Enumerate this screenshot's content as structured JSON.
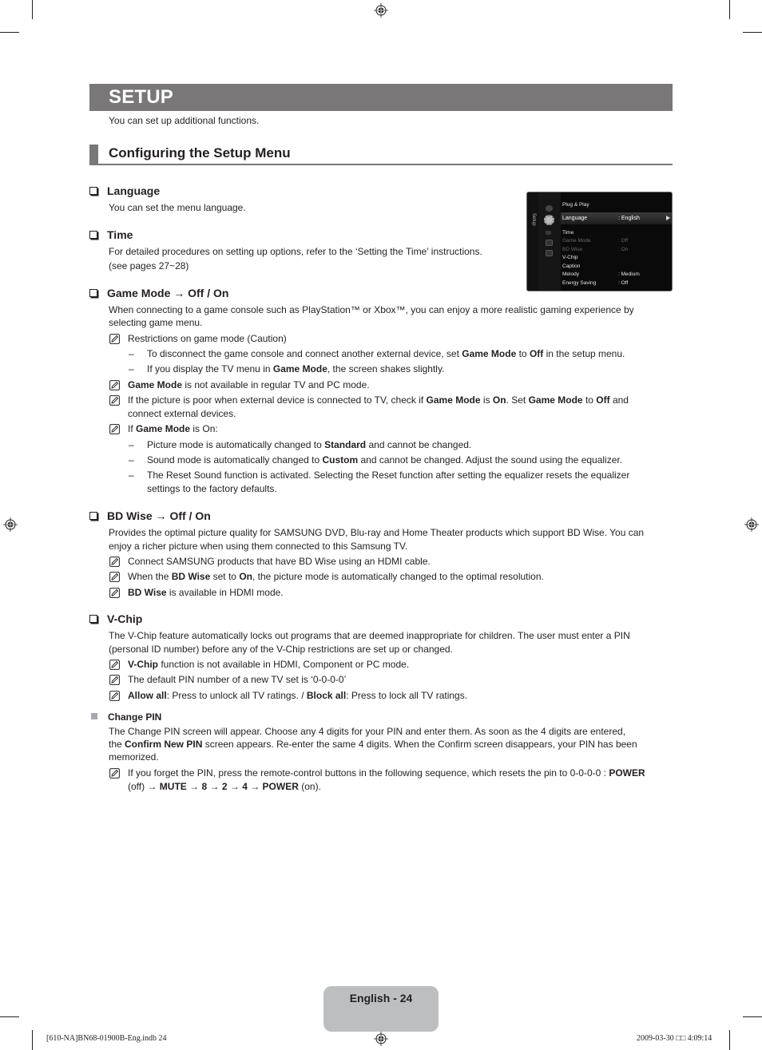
{
  "page": {
    "title": "SETUP",
    "intro": "You can set up additional functions.",
    "section_title": "Configuring the Setup Menu"
  },
  "items": {
    "language": {
      "title": "Language",
      "body": "You can set the menu language."
    },
    "time": {
      "title": "Time",
      "body1": "For detailed procedures on setting up options, refer to the ‘Setting the Time’ instructions.",
      "body2": "(see pages 27~28)"
    },
    "game_mode": {
      "title": "Game Mode → Off / On",
      "body1": "When connecting to a game console such as PlayStation™ or Xbox™, you can enjoy a more realistic gaming experience by",
      "body2": "selecting game menu.",
      "note1": "Restrictions on game mode (Caution)",
      "note1_dash1": {
        "a": "To disconnect the game console and connect another external device, set ",
        "b1": "Game Mode",
        "c": " to ",
        "b2": "Off",
        "d": " in the setup menu."
      },
      "note1_dash2": {
        "a": "If you display the TV menu in ",
        "b1": "Game Mode",
        "c": ", the screen shakes slightly."
      },
      "note2": {
        "b1": "Game Mode",
        "a": " is not available in regular TV and PC mode."
      },
      "note3": {
        "a": "If the picture is poor when external device is connected to TV, check if ",
        "b1": "Game Mode",
        "c": " is ",
        "b2": "On",
        "d": ". Set ",
        "b3": "Game Mode",
        "e": " to ",
        "b4": "Off",
        "f": " and",
        "line2": "connect external devices."
      },
      "note4": {
        "a": "If ",
        "b1": "Game Mode",
        "c": " is On:"
      },
      "note4_dash1": {
        "a": "Picture mode is automatically changed to ",
        "b1": "Standard",
        "c": " and cannot be changed."
      },
      "note4_dash2": {
        "a": "Sound mode is automatically changed to ",
        "b1": "Custom",
        "c": " and cannot be changed. Adjust the sound using the equalizer."
      },
      "note4_dash3": {
        "line1": "The Reset Sound function is activated. Selecting the Reset function after setting the equalizer resets the equalizer",
        "line2": "settings to the factory defaults."
      }
    },
    "bd_wise": {
      "title": "BD Wise → Off / On",
      "body1": "Provides the optimal picture quality for SAMSUNG DVD, Blu-ray and Home Theater products which support BD Wise. You can",
      "body2": "enjoy a richer picture when using them connected to this Samsung TV.",
      "note1": "Connect SAMSUNG products that have BD Wise using an HDMI cable.",
      "note2": {
        "a": "When the ",
        "b1": "BD Wise",
        "c": " set to ",
        "b2": "On",
        "d": ", the picture mode is automatically changed to the optimal resolution."
      },
      "note3": {
        "b1": "BD Wise",
        "a": " is available in HDMI mode."
      }
    },
    "v_chip": {
      "title": "V-Chip",
      "body1": "The V-Chip feature automatically locks out programs that are deemed inappropriate for children. The user must enter a PIN",
      "body2": "(personal ID number) before any of the V-Chip restrictions are set up or changed.",
      "note1": {
        "b1": "V-Chip",
        "a": " function is not available in HDMI, Component or PC mode."
      },
      "note2": "The default PIN number of a new TV set is ‘0-0-0-0’",
      "note3": {
        "b1": "Allow all",
        "a": ": Press to unlock all TV ratings. / ",
        "b2": "Block all",
        "c": ": Press to lock all TV ratings."
      }
    },
    "change_pin": {
      "title": "Change PIN",
      "body1": "The Change PIN screen will appear. Choose any 4 digits for your PIN and enter them. As soon as the 4 digits are entered,",
      "body2": {
        "a": "the ",
        "b1": "Confirm New PIN",
        "c": " screen appears. Re-enter the same 4 digits. When the Confirm screen disappears, your PIN has been"
      },
      "body3": "memorized.",
      "note1": {
        "a": "If you forget the PIN, press the remote-control buttons in the following sequence, which resets the pin to 0-0-0-0 : ",
        "b1": "POWER",
        "c": "(off) → ",
        "b2": "MUTE",
        "d": " → ",
        "b3": "8",
        "e": " → ",
        "b4": "2",
        "f": " → ",
        "b5": "4",
        "g": " → ",
        "b6": "POWER",
        "h": " (on)."
      }
    }
  },
  "osd": {
    "side_label": "Setup",
    "selected_index": 1,
    "rows": [
      {
        "label": "Plug & Play",
        "value": "",
        "state": "normal"
      },
      {
        "label": "Language",
        "value": ": English",
        "state": "selected"
      },
      {
        "label": "Time",
        "value": "",
        "state": "normal"
      },
      {
        "label": "Game Mode",
        "value": ": Off",
        "state": "disabled"
      },
      {
        "label": "BD Wise",
        "value": ": On",
        "state": "disabled"
      },
      {
        "label": "V-Chip",
        "value": "",
        "state": "normal"
      },
      {
        "label": "Caption",
        "value": "",
        "state": "normal"
      },
      {
        "label": "Melody",
        "value": ": Medium",
        "state": "normal"
      },
      {
        "label": "Energy Saving",
        "value": ": Off",
        "state": "normal"
      }
    ],
    "icons": [
      "picture-icon",
      "setup-gear-icon",
      "sound-icon",
      "input-icon",
      "support-icon"
    ]
  },
  "footer": {
    "page_label": "English - 24",
    "slug_left": "[610-NA]BN68-01900B-Eng.indb   24",
    "slug_right": "2009-03-30   □□ 4:09:14"
  },
  "colors": {
    "title_bar": "#797777",
    "page_tab": "#bcbec0",
    "text": "#231f20"
  }
}
